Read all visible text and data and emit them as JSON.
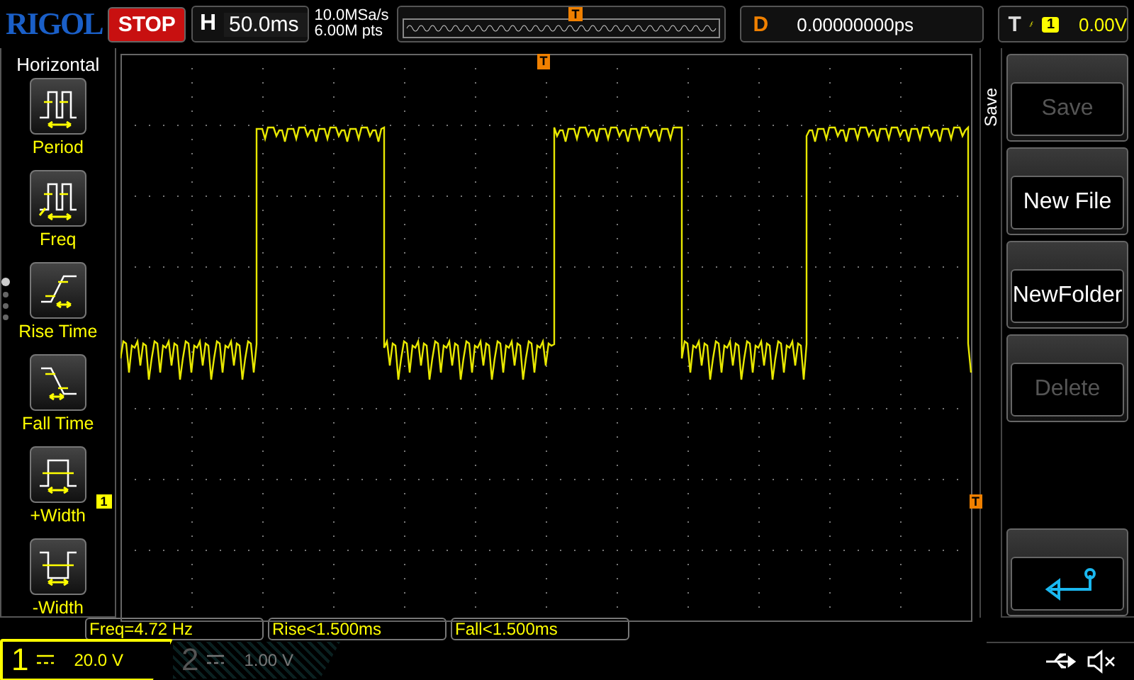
{
  "header": {
    "logo": "RIGOL",
    "run_state": "STOP",
    "timebase": {
      "label": "H",
      "value": "50.0ms"
    },
    "sample_rate": "10.0MSa/s",
    "memory_depth": "6.00M pts",
    "memory_marker": "T",
    "delay": {
      "label": "D",
      "value": "0.00000000ps"
    },
    "trigger": {
      "label": "T",
      "source": "1",
      "level": "0.00V"
    }
  },
  "measure_menu": {
    "title": "Horizontal",
    "items": [
      {
        "label": "Period"
      },
      {
        "label": "Freq"
      },
      {
        "label": "Rise Time"
      },
      {
        "label": "Fall Time"
      },
      {
        "label": "+Width"
      },
      {
        "label": "-Width"
      }
    ],
    "pages": [
      {
        "selected": true
      },
      {
        "selected": false
      },
      {
        "selected": false
      },
      {
        "selected": false
      }
    ]
  },
  "screen": {
    "trigger_position_marker": "T",
    "channel_marker": "1",
    "trigger_level_marker": "T"
  },
  "save_menu": {
    "title": "Save",
    "buttons": [
      {
        "kind": "text",
        "label": "Save",
        "disabled": true
      },
      {
        "kind": "text",
        "label": "New File",
        "disabled": false
      },
      {
        "kind": "text",
        "label": "NewFolder",
        "disabled": false
      },
      {
        "kind": "text",
        "label": "Delete",
        "disabled": true
      },
      {
        "kind": "back",
        "disabled": false
      }
    ]
  },
  "measurements": [
    "Freq=4.72 Hz",
    "Rise<1.500ms",
    "Fall<1.500ms"
  ],
  "channels": [
    {
      "number": "1",
      "scale": "20.0 V",
      "on": true
    },
    {
      "number": "2",
      "scale": "1.00 V",
      "on": false
    }
  ]
}
